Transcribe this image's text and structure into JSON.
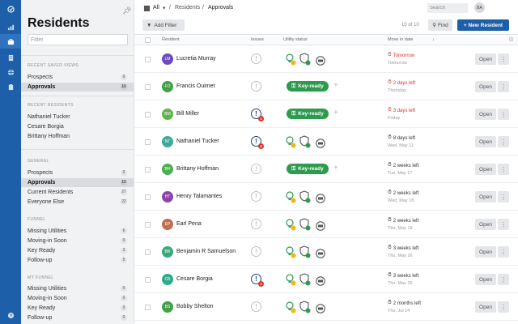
{
  "rail": {
    "icons": [
      "check-circle-icon",
      "bar-chart-icon",
      "briefcase-icon",
      "building-icon",
      "globe-icon",
      "clipboard-icon",
      "help-icon"
    ]
  },
  "sidebar": {
    "title": "Residents",
    "filter_placeholder": "Filter",
    "sections": [
      {
        "heading": "RECENT SAVED VIEWS",
        "items": [
          {
            "label": "Prospects",
            "count": "0"
          },
          {
            "label": "Approvals",
            "count": "10",
            "selected": true
          }
        ]
      },
      {
        "heading": "RECENT RESIDENTS",
        "items": [
          {
            "label": "Nathaniel Tucker"
          },
          {
            "label": "Cesare Borgia"
          },
          {
            "label": "Brittany Hoffman"
          }
        ]
      },
      {
        "heading": "GENERAL",
        "items": [
          {
            "label": "Prospects",
            "count": "0"
          },
          {
            "label": "Approvals",
            "count": "10",
            "selected": true
          },
          {
            "label": "Current Residents",
            "count": "27"
          },
          {
            "label": "Everyone Else",
            "count": "22"
          }
        ]
      },
      {
        "heading": "FUNNEL",
        "items": [
          {
            "label": "Missing Utilities",
            "count": "6"
          },
          {
            "label": "Moving-in Soon",
            "count": "0"
          },
          {
            "label": "Key Ready",
            "count": "3"
          },
          {
            "label": "Follow-up",
            "count": "5"
          }
        ]
      },
      {
        "heading": "MY FUNNEL",
        "items": [
          {
            "label": "Missing Utilities",
            "count": "0"
          },
          {
            "label": "Moving-in Soon",
            "count": "0"
          },
          {
            "label": "Key Ready",
            "count": "0"
          },
          {
            "label": "Follow-up",
            "count": "0"
          }
        ]
      }
    ]
  },
  "topbar": {
    "crumbs": [
      "All",
      "Residents",
      "Approvals"
    ],
    "search_placeholder": "Search",
    "user_initials": "BA"
  },
  "toolbar": {
    "add_filter": "Add Filter",
    "count_text": "10 of 10",
    "find": "Find",
    "new_resident": "+ New Resident"
  },
  "table": {
    "headers": {
      "resident": "Resident",
      "issues": "Issues",
      "utility": "Utility status",
      "movein": "Move in date"
    },
    "open_label": "Open",
    "key_ready_label": "Key-ready",
    "rows": [
      {
        "initials": "LM",
        "name": "Lucretia Murray",
        "avatar_color": "#6a4bc4",
        "issue": "none",
        "utility": "icons",
        "due": "Tomorrow",
        "date": "Tomorrow",
        "urgent": true
      },
      {
        "initials": "FO",
        "name": "Francis Ouimet",
        "avatar_color": "#43a047",
        "issue": "none",
        "utility": "key-ready",
        "due": "2 days left",
        "date": "Thursday",
        "urgent": true
      },
      {
        "initials": "BM",
        "name": "Bill Miller",
        "avatar_color": "#5fb34a",
        "issue": "alert",
        "issue_count": "1",
        "utility": "key-ready",
        "due": "3 days left",
        "date": "Friday",
        "urgent": true
      },
      {
        "initials": "NT",
        "name": "Nathaniel Tucker",
        "avatar_color": "#3fa99b",
        "issue": "alert",
        "issue_count": "3",
        "utility": "icons",
        "due": "8 days left",
        "date": "Wed, May 11",
        "urgent": false
      },
      {
        "initials": "BH",
        "name": "Brittany Hoffman",
        "avatar_color": "#4caf50",
        "issue": "none",
        "utility": "key-ready",
        "due": "2 weeks left",
        "date": "Tue, May 17",
        "urgent": false
      },
      {
        "initials": "HT",
        "name": "Henry Talamantes",
        "avatar_color": "#8e44ad",
        "issue": "none",
        "utility": "icons",
        "due": "2 weeks left",
        "date": "Wed, May 18",
        "urgent": false
      },
      {
        "initials": "EP",
        "name": "Earl Pena",
        "avatar_color": "#c0704a",
        "issue": "none",
        "utility": "icons",
        "due": "2 weeks left",
        "date": "Thu, May 19",
        "urgent": false
      },
      {
        "initials": "BR",
        "name": "Benjamin R Samuelson",
        "avatar_color": "#3aa87a",
        "issue": "none",
        "utility": "icons",
        "due": "3 weeks left",
        "date": "Thu, May 26",
        "urgent": false
      },
      {
        "initials": "CB",
        "name": "Cesare Borgia",
        "avatar_color": "#2eaa8a",
        "issue": "alert",
        "issue_count": "1",
        "utility": "icons",
        "due": "3 weeks left",
        "date": "Thu, May 26",
        "urgent": false
      },
      {
        "initials": "BS",
        "name": "Bobby Shelton",
        "avatar_color": "#43a047",
        "issue": "none",
        "utility": "icons",
        "due": "2 months left",
        "date": "Thu, Jul 14",
        "urgent": false
      }
    ]
  },
  "colors": {
    "brand": "#1d5fa8",
    "key_ready": "#2e9a4e",
    "urgent": "#d9342b"
  }
}
